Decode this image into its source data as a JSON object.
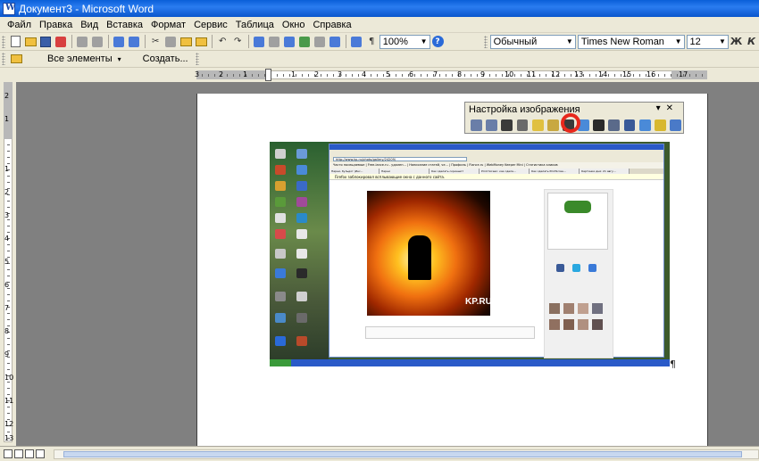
{
  "window": {
    "title": "Документ3 - Microsoft Word"
  },
  "menu": {
    "items": [
      "Файл",
      "Правка",
      "Вид",
      "Вставка",
      "Формат",
      "Сервис",
      "Таблица",
      "Окно",
      "Справка"
    ]
  },
  "toolbar": {
    "zoom": "100%",
    "style": "Обычный",
    "font": "Times New Roman",
    "size": "12",
    "bold_label": "Ж",
    "italic_label": "К"
  },
  "toolbar2": {
    "all_elements": "Все элементы",
    "create": "Создать..."
  },
  "ruler": {
    "h_numbers": [
      "3",
      "2",
      "1",
      "1",
      "2",
      "3",
      "4",
      "5",
      "6",
      "7",
      "8",
      "9",
      "10",
      "11",
      "12",
      "13",
      "14",
      "15",
      "16",
      "17"
    ],
    "v_numbers": [
      "2",
      "1",
      "1",
      "2",
      "3",
      "4",
      "5",
      "6",
      "7",
      "8",
      "9",
      "10",
      "11",
      "12",
      "13"
    ]
  },
  "picture_toolbar": {
    "title": "Настройка изображения"
  },
  "embedded_screenshot": {
    "address": "http://www.kp.ru/photo/gallery/24209/",
    "infobar": "Firefox заблокировал всплывающие окна с данного сайта.",
    "watermark": "KP.RU",
    "favorites": "Часто посещаемые | Free-lance.ru - удален... | Написание статей, че... | Профиль | Flance.ru | WebMoney Keeper Mini | Статистика кликов",
    "tabs": [
      "Парни, бульдог (Инс...",
      "Парни",
      "Как сделать скриншот",
      "Print Screen: как сдела...",
      "Как сделать PrintScree...",
      "Картинки дня: 21 авгу..."
    ]
  }
}
